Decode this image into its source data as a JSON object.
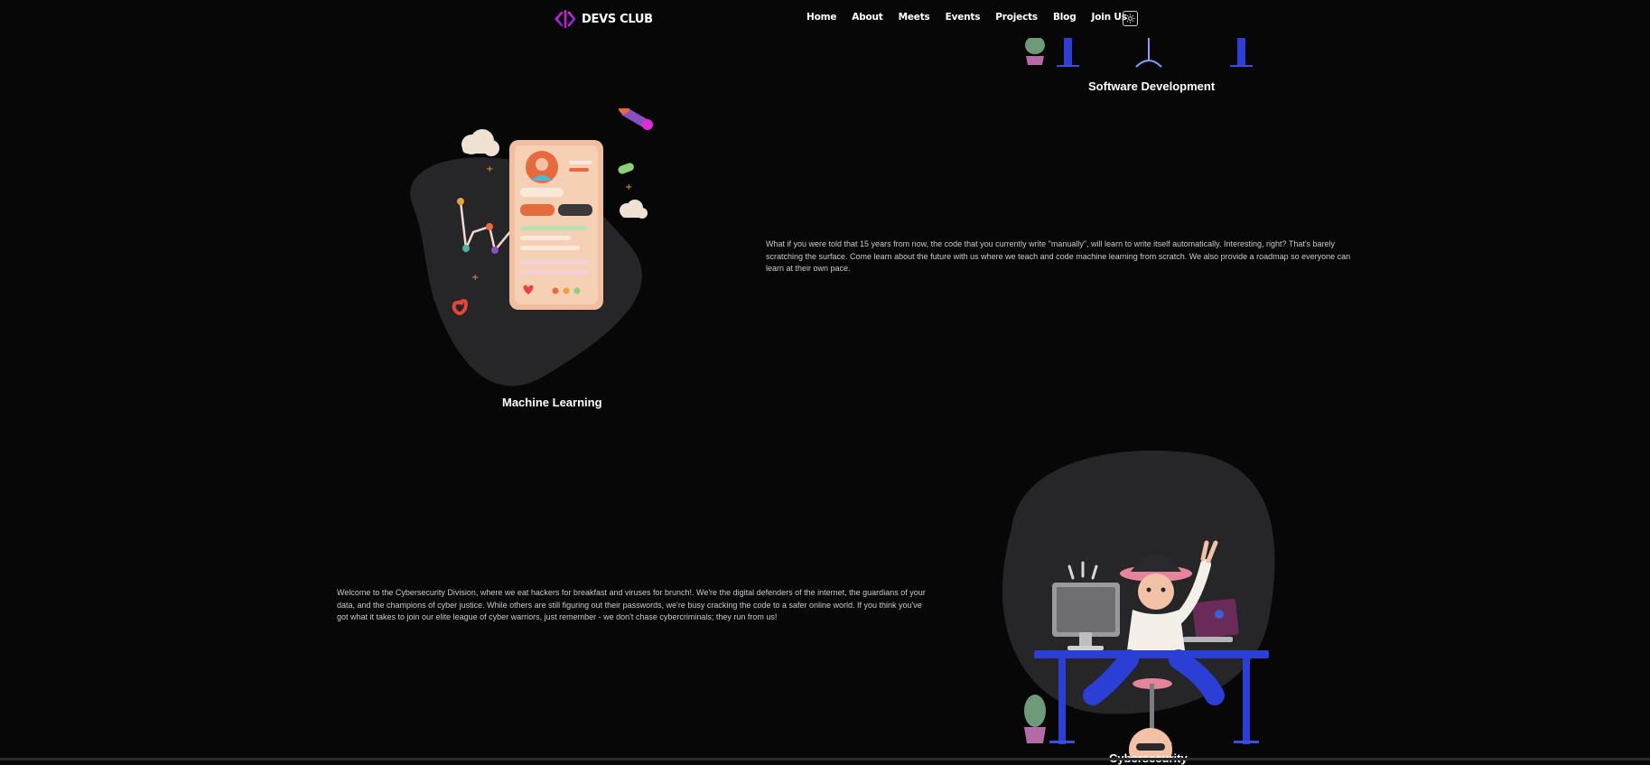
{
  "brand": {
    "name": "DEVS CLUB",
    "logo_icon": "code-brackets-icon",
    "accent": "#c21fd1"
  },
  "nav": {
    "links": [
      "Home",
      "About",
      "Meets",
      "Events",
      "Projects",
      "Blog",
      "Join Us"
    ],
    "theme_toggle_icon": "sun-icon"
  },
  "sections": {
    "software": {
      "title": "Software Development"
    },
    "ml": {
      "title": "Machine Learning",
      "text": "What if you were told that 15 years from now, the code that you currently write \"manually\", will learn to write itself automatically. Interesting, right? That's barely scratching the surface. Come learn about the future with us where we teach and code machine learning from scratch. We also provide a roadmap so everyone can learn at their own pace."
    },
    "cyber": {
      "title": "Cybersecurity",
      "text": "Welcome to the Cybersecurity Division, where we eat hackers for breakfast and viruses for brunch!. We're the digital defenders of the internet, the guardians of your data, and the champions of cyber justice. While others are still figuring out their passwords, we're busy cracking the code to a safer online world. If you think you've got what it takes to join our elite league of cyber warriors, just remember - we don't chase cybercriminals; they run from us!"
    }
  },
  "colors": {
    "background": "#070708",
    "blob": "#262628",
    "desk_blue": "#2b3fd6"
  }
}
